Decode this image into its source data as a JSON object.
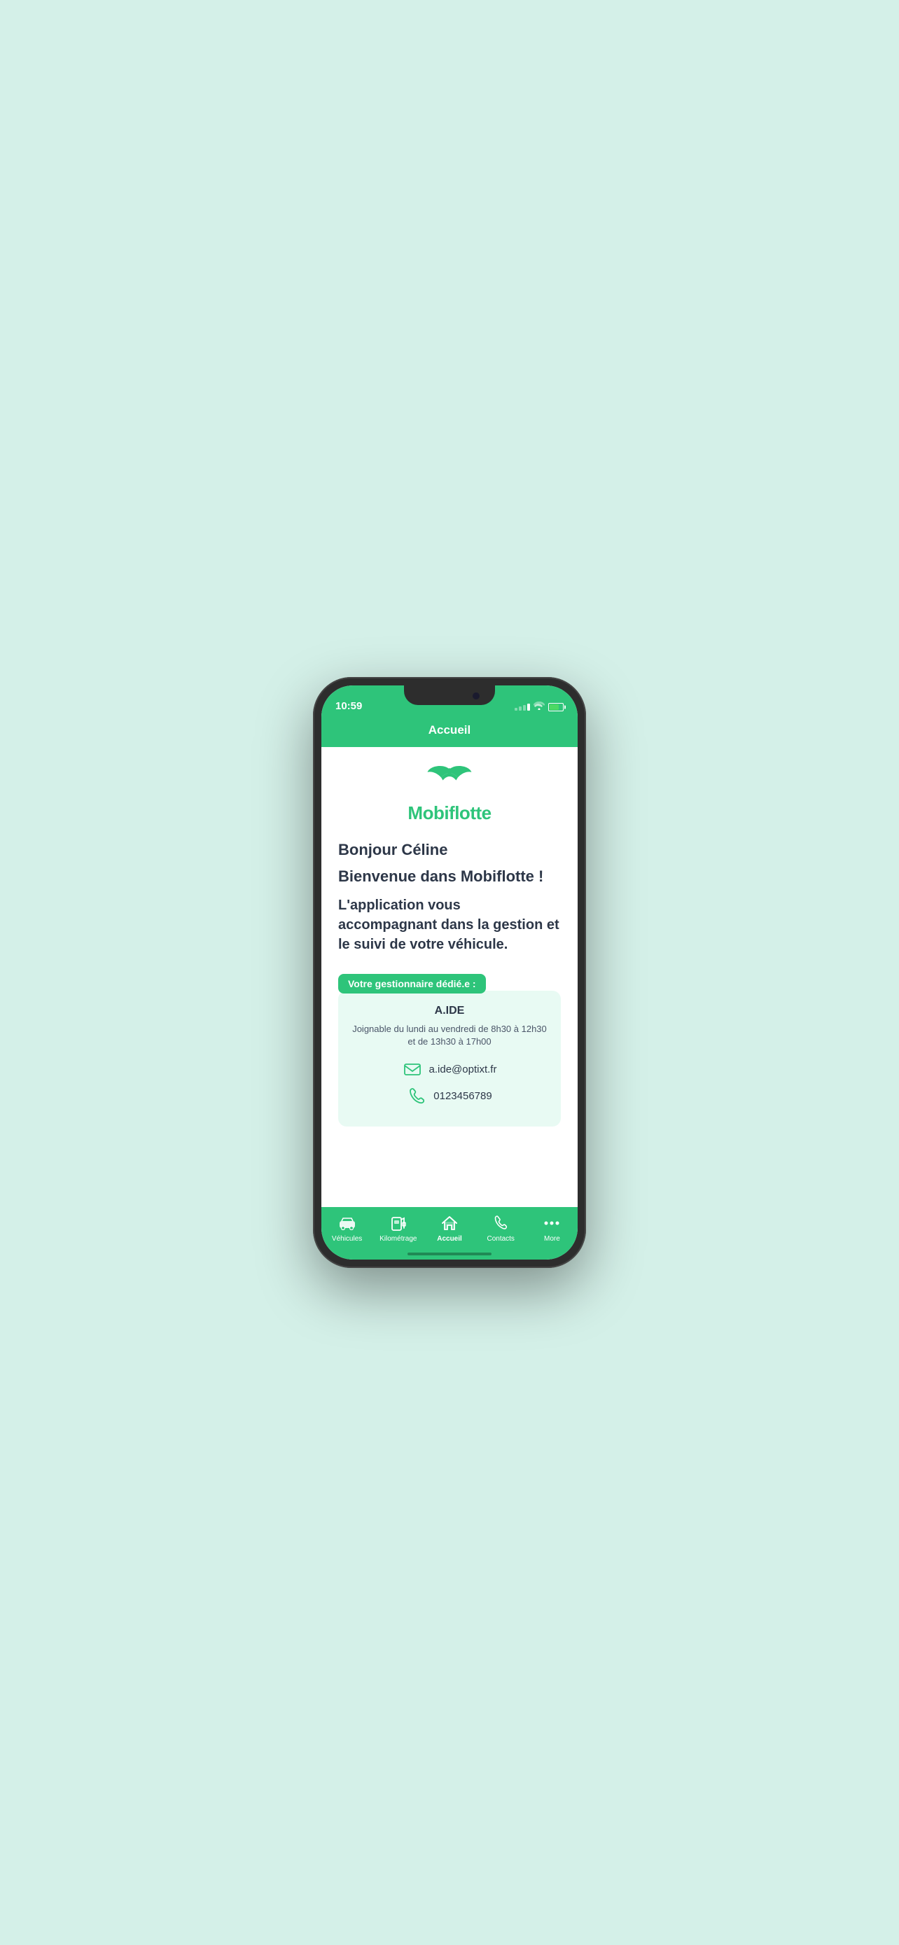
{
  "phone": {
    "status_bar": {
      "time": "10:59",
      "wifi": true,
      "battery": 70
    },
    "header": {
      "title": "Accueil"
    },
    "logo": {
      "text": "Mobiflotte"
    },
    "content": {
      "greeting": "Bonjour Céline",
      "welcome_title": "Bienvenue dans Mobiflotte !",
      "description": "L'application vous accompagnant dans la gestion et le suivi de votre véhicule.",
      "manager_badge": "Votre gestionnaire dédié.e :",
      "manager_name": "A.IDE",
      "manager_hours": "Joignable du lundi au vendredi de 8h30 à 12h30 et de 13h30 à 17h00",
      "manager_email": "a.ide@optixt.fr",
      "manager_phone": "0123456789"
    },
    "nav": {
      "items": [
        {
          "label": "Véhicules",
          "icon": "car"
        },
        {
          "label": "Kilométrage",
          "icon": "fuel"
        },
        {
          "label": "Accueil",
          "icon": "home",
          "active": true
        },
        {
          "label": "Contacts",
          "icon": "phone"
        },
        {
          "label": "More",
          "icon": "dots"
        }
      ]
    }
  }
}
